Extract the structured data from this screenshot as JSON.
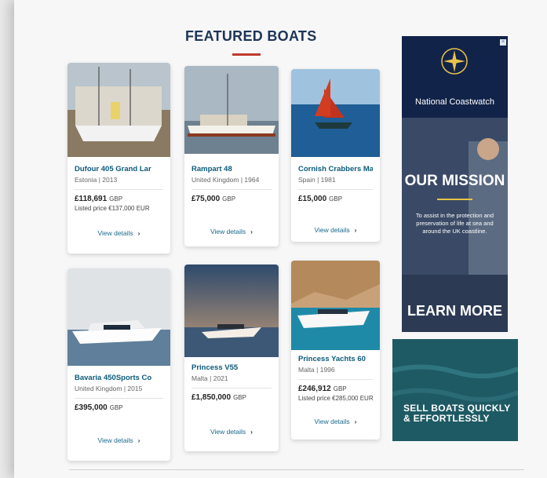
{
  "section": {
    "title": "FEATURED BOATS"
  },
  "boats": [
    {
      "name": "Dufour 405 Grand Lar",
      "location": "Estonia | 2013",
      "price": "£118,691",
      "currency": "GBP",
      "listed": "Listed price €137,000 EUR",
      "view": "View details"
    },
    {
      "name": "Rampart 48",
      "location": "United Kingdom | 1964",
      "price": "£75,000",
      "currency": "GBP",
      "listed": "",
      "view": "View details"
    },
    {
      "name": "Cornish Crabbers Mar",
      "location": "Spain | 1981",
      "price": "£15,000",
      "currency": "GBP",
      "listed": "",
      "view": "View details"
    },
    {
      "name": "Bavaria 450Sports Co",
      "location": "United Kingdom | 2015",
      "price": "£395,000",
      "currency": "GBP",
      "listed": "",
      "view": "View details"
    },
    {
      "name": "Princess V55",
      "location": "Malta | 2021",
      "price": "£1,850,000",
      "currency": "GBP",
      "listed": "",
      "view": "View details"
    },
    {
      "name": "Princess Yachts 60",
      "location": "Malta | 1996",
      "price": "£246,912",
      "currency": "GBP",
      "listed": "Listed price €285,000 EUR",
      "view": "View details"
    }
  ],
  "ad_coastwatch": {
    "brand": "National Coastwatch",
    "headline": "OUR MISSION",
    "text": "To assist in the protection and preservation of life at sea and around the UK coastline.",
    "cta": "LEARN MORE",
    "close": "×"
  },
  "ad_sell": {
    "headline": "SELL BOATS QUICKLY & EFFORTLESSLY"
  },
  "icons": {
    "chevron": "›"
  }
}
